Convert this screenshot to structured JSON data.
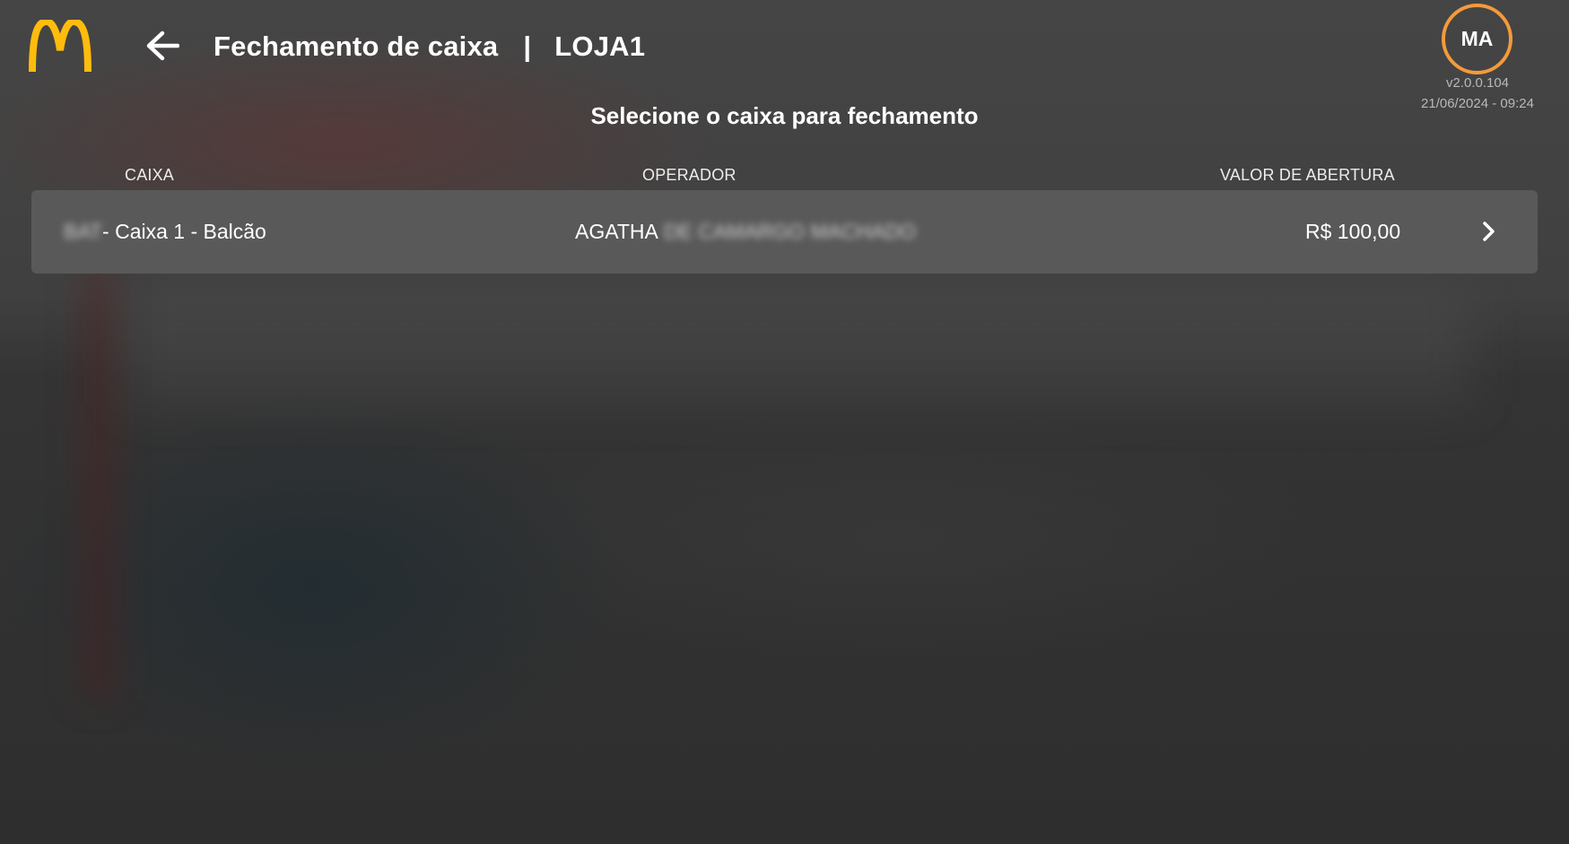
{
  "header": {
    "logo_icon": "mcdonalds-arches-logo",
    "back_icon": "arrow-left-icon",
    "title": "Fechamento de caixa",
    "separator": "|",
    "store": "LOJA1"
  },
  "user": {
    "initials": "MA",
    "ring_color": "#f39a3c",
    "version": "v2.0.0.104",
    "datetime": "21/06/2024 - 09:24"
  },
  "subtitle": "Selecione o caixa para fechamento",
  "table": {
    "columns": [
      "CAIXA",
      "OPERADOR",
      "VALOR DE ABERTURA"
    ],
    "rows": [
      {
        "caixa_prefix": "BAT",
        "caixa": " - Caixa 1 - Balcão",
        "operador": "AGATHA",
        "operador_hidden": "DE CAMARGO MACHADO",
        "valor": "R$ 100,00",
        "action_icon": "chevron-right-icon"
      }
    ]
  },
  "colors": {
    "accent": "#f39a3c",
    "logo": "#ffbc0d",
    "row_bg": "#595959"
  }
}
